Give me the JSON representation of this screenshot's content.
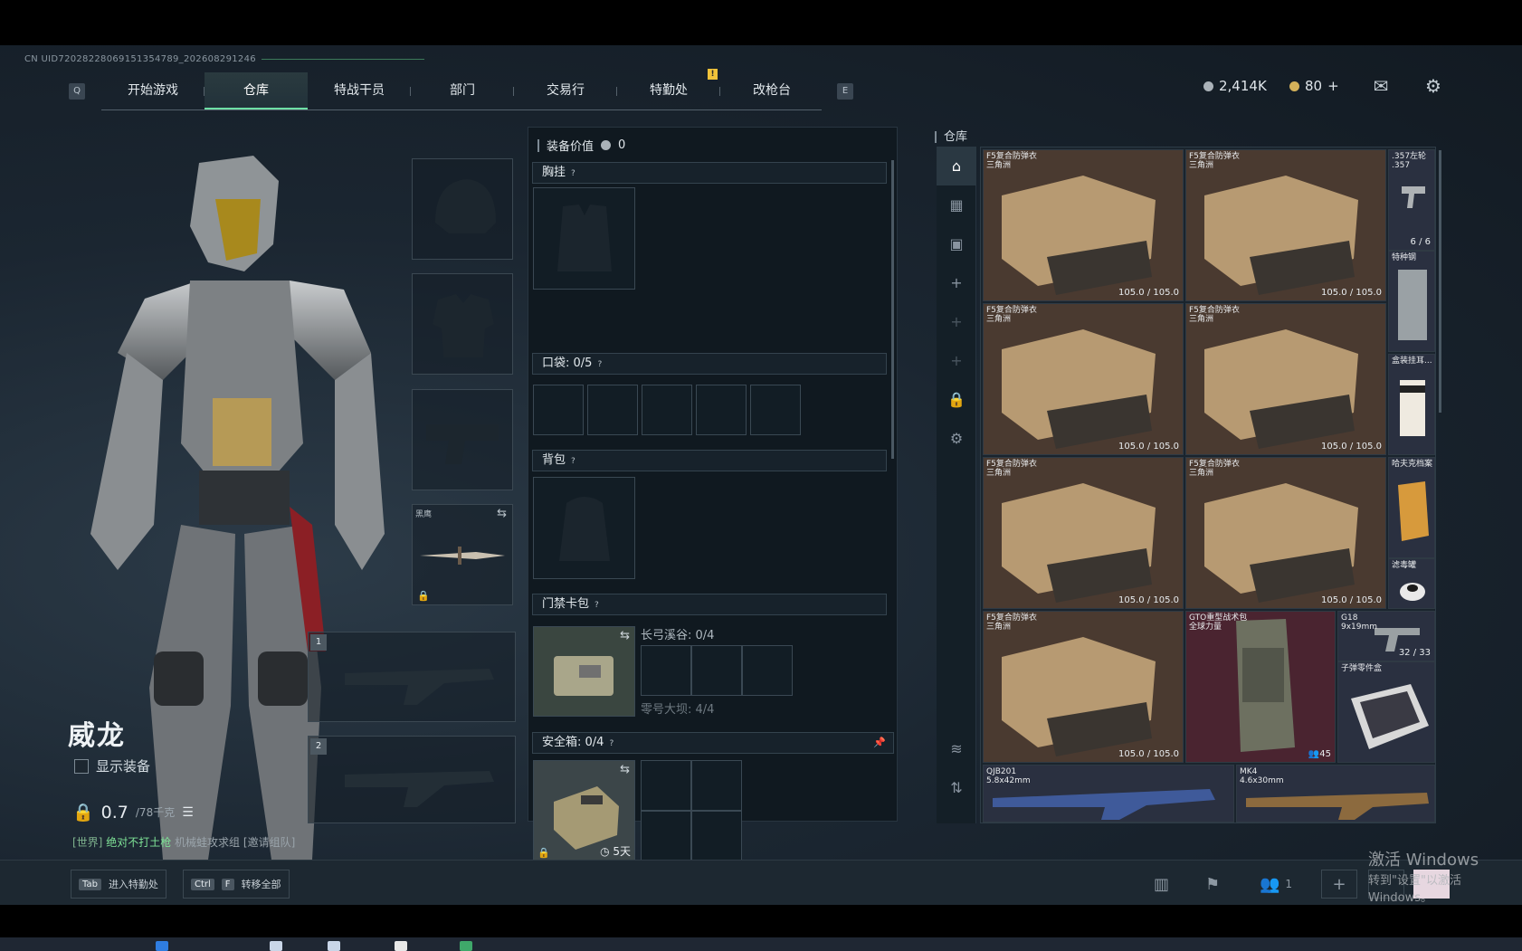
{
  "uid": "CN UID72028228069151354789_202608291246",
  "nav": {
    "key_left": "Q",
    "key_right": "E",
    "tabs": [
      {
        "label": "开始游戏"
      },
      {
        "label": "仓库"
      },
      {
        "label": "特战干员"
      },
      {
        "label": "部门"
      },
      {
        "label": "交易行"
      },
      {
        "label": "特勤处"
      },
      {
        "label": "改枪台"
      }
    ],
    "badge": "!"
  },
  "currency": {
    "coins": "2,414K",
    "premium": "80",
    "add": "+"
  },
  "character": {
    "name": "威龙",
    "show_equip_label": "显示装备",
    "weight_value": "0.7",
    "weight_max": "/78千克",
    "chat": {
      "channel": "[世界]",
      "msg1": "绝对不打土枪",
      "msg2": "机械蛙攻求组",
      "msg3": "[邀请组队]"
    }
  },
  "slots": {
    "melee_label": "黑鹰",
    "weapon1_num": "1",
    "weapon2_num": "2"
  },
  "mid": {
    "equip_value_label": "装备价值",
    "equip_value": "0",
    "chest_label": "胸挂",
    "pocket_label": "口袋:",
    "pocket_count": "0/5",
    "backpack_label": "背包",
    "keycard_label": "门禁卡包",
    "keycard_line1": "长弓溪谷: 0/4",
    "keycard_line2": "零号大坝: 4/4",
    "safe_label": "安全箱:",
    "safe_count": "0/4",
    "safe_timer": "5天",
    "help": "?"
  },
  "storage": {
    "title": "仓库",
    "items": [
      {
        "name": "F5复合防弹衣",
        "sub": "三角洲",
        "dur": "105.0 / 105.0"
      },
      {
        "name": "F5复合防弹衣",
        "sub": "三角洲",
        "dur": "105.0 / 105.0"
      },
      {
        "name": ".357左轮",
        "sub": ".357",
        "dur": "6 / 6"
      },
      {
        "name": "特种钢",
        "sub": "",
        "dur": ""
      },
      {
        "name": "F5复合防弹衣",
        "sub": "三角洲",
        "dur": "105.0 / 105.0"
      },
      {
        "name": "F5复合防弹衣",
        "sub": "三角洲",
        "dur": "105.0 / 105.0"
      },
      {
        "name": "盒装挂耳...",
        "sub": "",
        "dur": ""
      },
      {
        "name": "F5复合防弹衣",
        "sub": "三角洲",
        "dur": "105.0 / 105.0"
      },
      {
        "name": "F5复合防弹衣",
        "sub": "三角洲",
        "dur": "105.0 / 105.0"
      },
      {
        "name": "哈夫克档案",
        "sub": "",
        "dur": ""
      },
      {
        "name": "滤毒罐",
        "sub": "",
        "dur": ""
      },
      {
        "name": "F5复合防弹衣",
        "sub": "三角洲",
        "dur": "105.0 / 105.0"
      },
      {
        "name": "GTO重型战术包",
        "sub": "全球力量",
        "dur": "45"
      },
      {
        "name": "G18",
        "sub": "9x19mm",
        "dur": "32 / 33"
      },
      {
        "name": "子弹零件盒",
        "sub": "",
        "dur": ""
      },
      {
        "name": "QJB201",
        "sub": "5.8x42mm",
        "dur": ""
      },
      {
        "name": "MK4",
        "sub": "4.6x30mm",
        "dur": ""
      }
    ]
  },
  "bottom": {
    "tab_key": "Tab",
    "tab_label": "进入特勤处",
    "ctrl_key": "Ctrl",
    "f_key": "F",
    "transfer_label": "转移全部",
    "friends_count": "1"
  },
  "watermark": {
    "line1": "激活 Windows",
    "line2": "转到\"设置\"以激活 Windows。"
  },
  "colors": {
    "accent": "#6ee0a5",
    "item_bg_brown": "#4a3a30",
    "item_bg_red": "#4a2430",
    "item_bg_blue": "#2a3040"
  }
}
